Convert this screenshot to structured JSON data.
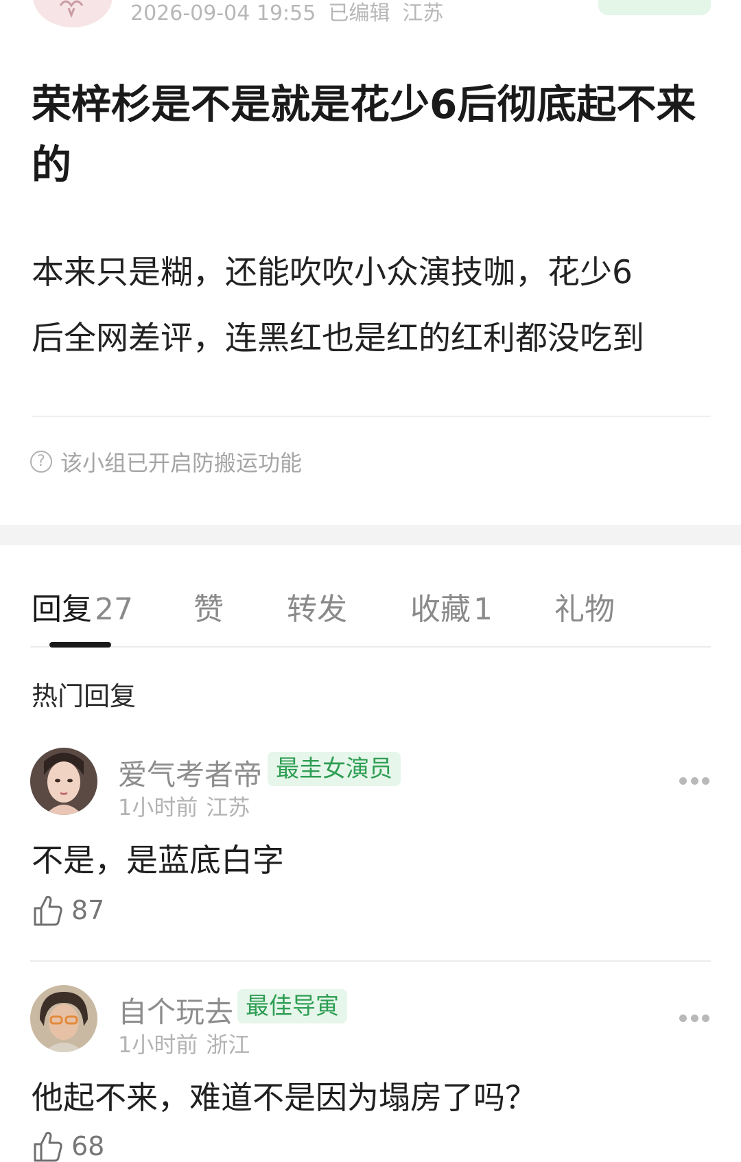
{
  "post": {
    "timestamp": "2026-09-04 19:55",
    "edited_label": "已编辑",
    "location": "江苏",
    "title": "荣梓杉是不是就是花少6后彻底起不来的",
    "body_line1": "本来只是糊，还能吹吹小众演技咖，花少6",
    "body_line2": "后全网差评，连黑红也是红的红利都没吃到",
    "notice": "该小组已开启防搬运功能"
  },
  "tabs": [
    {
      "label": "回复",
      "count": "27"
    },
    {
      "label": "赞",
      "count": ""
    },
    {
      "label": "转发",
      "count": ""
    },
    {
      "label": "收藏",
      "count": "1"
    },
    {
      "label": "礼物",
      "count": ""
    }
  ],
  "hot_replies_label": "热门回复",
  "replies": [
    {
      "username": "爱气考者帝",
      "badge": "最圭女演员",
      "time": "1小时前",
      "location": "江苏",
      "text": "不是，是蓝底白字",
      "likes": "87"
    },
    {
      "username": "自个玩去",
      "badge": "最佳导寅",
      "time": "1小时前",
      "location": "浙江",
      "text": "他起不来，难道不是因为塌房了吗？",
      "likes": "68"
    }
  ],
  "colors": {
    "badge_bg": "#e6f6ea",
    "badge_text": "#2e9e54",
    "follow_button_bg": "#e3f6e8"
  }
}
